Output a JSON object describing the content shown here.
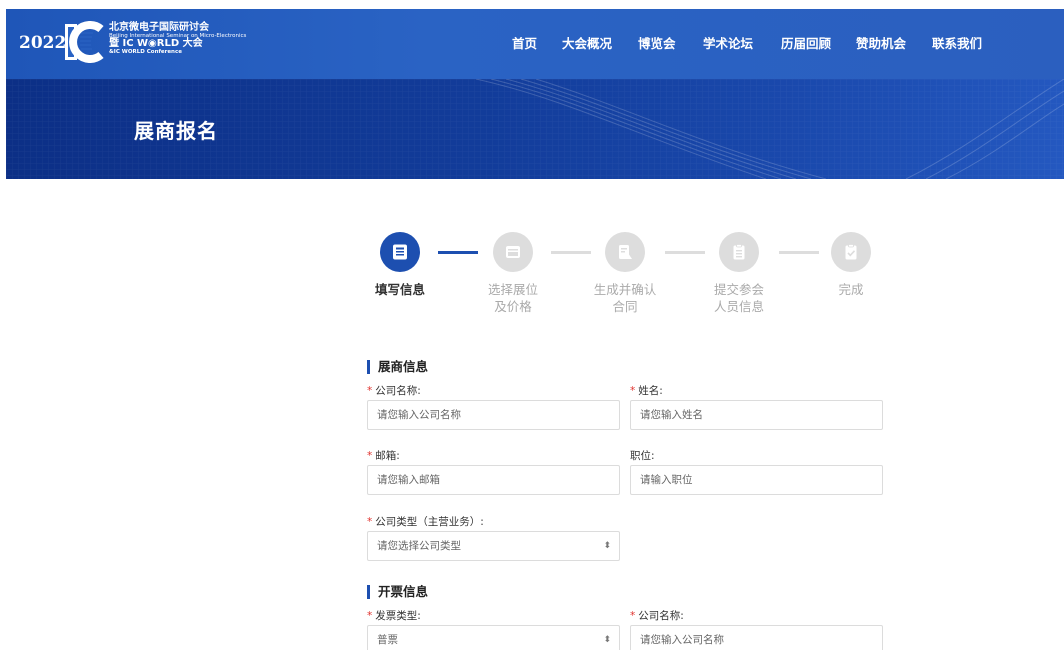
{
  "header": {
    "year": "2022",
    "logo_cn": "北京微电子国际研讨会",
    "logo_en": "Beijing International Seminar on Micro-Electronics",
    "logo_ic": "暨 IC W◉RLD 大会",
    "logo_en2": "&IC WORLD Conference",
    "nav": [
      "首页",
      "大会概况",
      "博览会",
      "学术论坛",
      "历届回顾",
      "赞助机会",
      "联系我们"
    ]
  },
  "banner": {
    "title": "展商报名"
  },
  "steps": [
    {
      "label_1": "填写信息",
      "label_2": "",
      "icon": "form-icon",
      "active": true
    },
    {
      "label_1": "选择展位",
      "label_2": "及价格",
      "icon": "booth-icon",
      "active": false
    },
    {
      "label_1": "生成并确认",
      "label_2": "合同",
      "icon": "contract-icon",
      "active": false
    },
    {
      "label_1": "提交参会",
      "label_2": "人员信息",
      "icon": "clipboard-icon",
      "active": false
    },
    {
      "label_1": "完成",
      "label_2": "",
      "icon": "check-clipboard-icon",
      "active": false
    }
  ],
  "exhibitor": {
    "title": "展商信息",
    "company_label": "公司名称:",
    "company_placeholder": "请您输入公司名称",
    "name_label": "姓名:",
    "name_placeholder": "请您输入姓名",
    "email_label": "邮箱:",
    "email_placeholder": "请您输入邮箱",
    "position_label": "职位:",
    "position_placeholder": "请输入职位",
    "type_label": "公司类型（主营业务）:",
    "type_value": "请您选择公司类型"
  },
  "invoice": {
    "title": "开票信息",
    "invoice_type_label": "发票类型:",
    "invoice_type_value": "普票",
    "company_label": "公司名称:",
    "company_placeholder": "请您输入公司名称"
  },
  "colors": {
    "brand": "#1d4fb0",
    "required": "#e0322d",
    "inactive": "#dddddd"
  }
}
